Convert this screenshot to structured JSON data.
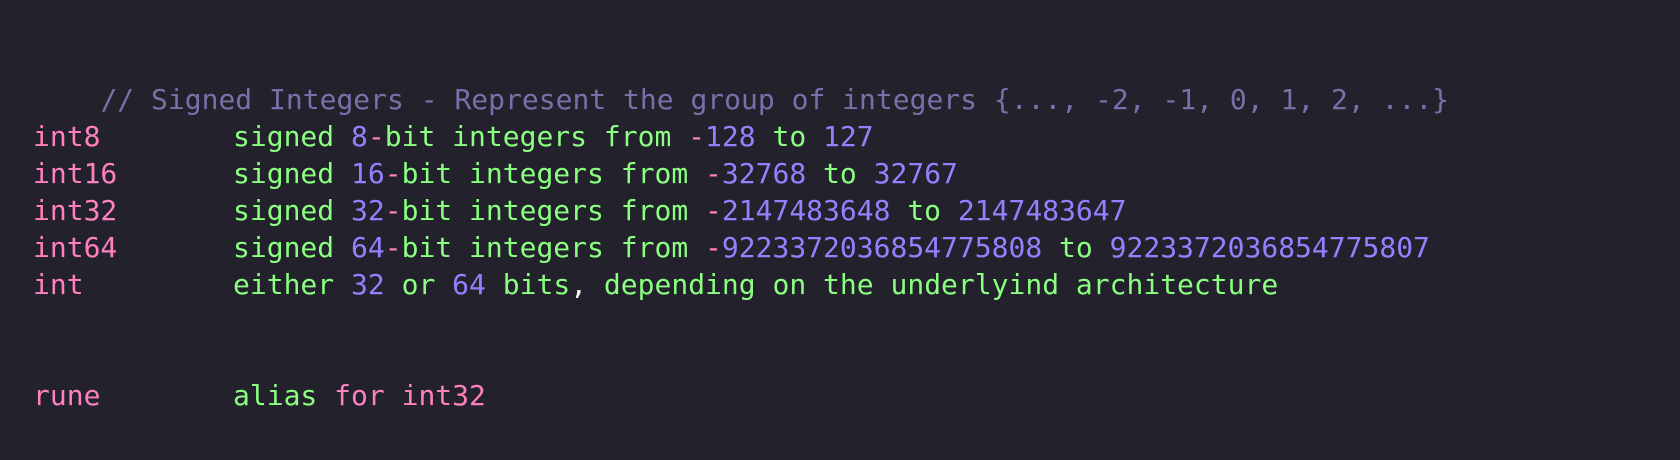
{
  "colors": {
    "background": "#22212c",
    "comment": "#7970a9",
    "keyword": "#ff80bf",
    "text": "#8aff80",
    "number": "#9580ff",
    "punctuation": "#f8f8f2"
  },
  "comment": "// Signed Integers - Represent the group of integers {..., -2, -1, 0, 1, 2, ...}",
  "rows": [
    {
      "type": "int8",
      "desc_prefix": "signed ",
      "bits": "8",
      "bits_sep": "-",
      "desc_mid": "bit integers from ",
      "min_sign": "-",
      "min": "128",
      "to": " to ",
      "max": "127"
    },
    {
      "type": "int16",
      "desc_prefix": "signed ",
      "bits": "16",
      "bits_sep": "-",
      "desc_mid": "bit integers from ",
      "min_sign": "-",
      "min": "32768",
      "to": " to ",
      "max": "32767"
    },
    {
      "type": "int32",
      "desc_prefix": "signed ",
      "bits": "32",
      "bits_sep": "-",
      "desc_mid": "bit integers from ",
      "min_sign": "-",
      "min": "2147483648",
      "to": " to ",
      "max": "2147483647"
    },
    {
      "type": "int64",
      "desc_prefix": "signed ",
      "bits": "64",
      "bits_sep": "-",
      "desc_mid": "bit integers from ",
      "min_sign": "-",
      "min": "9223372036854775808",
      "to": " to ",
      "max": "9223372036854775807"
    }
  ],
  "int_row": {
    "type": "int",
    "w1": "either ",
    "n1": "32",
    "w2": " or ",
    "n2": "64",
    "w3": " bits",
    "comma": ",",
    "w4": " depending on the underlyind architecture"
  },
  "rune_row": {
    "type": "rune",
    "alias": "alias ",
    "for_kw": "for",
    "space": " ",
    "target": "int32"
  }
}
